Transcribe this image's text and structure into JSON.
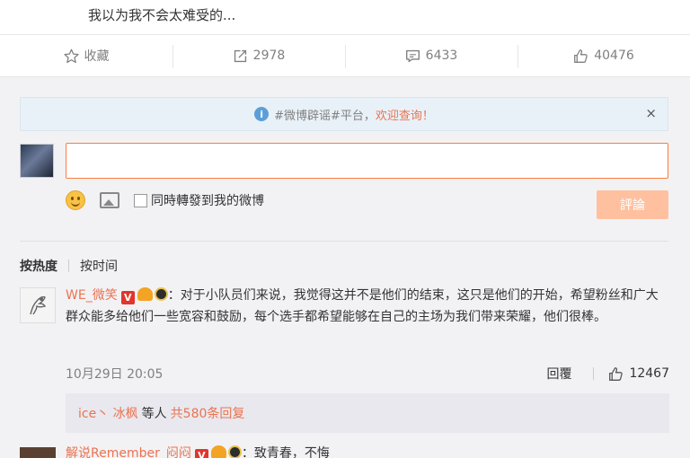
{
  "post": {
    "text": "我以为我不会太难受的..."
  },
  "actions": [
    {
      "label": "收藏",
      "icon": "star-icon"
    },
    {
      "label": "2978",
      "icon": "repost-icon"
    },
    {
      "label": "6433",
      "icon": "comment-icon"
    },
    {
      "label": "40476",
      "icon": "like-icon"
    }
  ],
  "notice": {
    "prefix": "#微博辟谣#平台，",
    "link": "欢迎查询！",
    "close": "×"
  },
  "compose": {
    "input_value": "",
    "forward_label": "同時轉發到我的微博",
    "submit_label": "評論"
  },
  "sort": {
    "active": "按热度",
    "other": "按时间"
  },
  "comments": [
    {
      "user": "WE_微笑",
      "text": "：对于小队员们来说，我觉得这并不是他们的结束，这只是他们的开始，希望粉丝和广大群众能多给他们一些宽容和鼓励，每个选手都希望能够在自己的主场为我们带来荣耀，他们很棒。",
      "time": "10月29日 20:05",
      "reply_label": "回覆",
      "likes": "12467",
      "replies": {
        "users": "ice丶 冰枫",
        "mid": "等人",
        "more": "共580条回复"
      }
    },
    {
      "user": "解说Remember_闷闷",
      "text": "：致青春，不悔"
    }
  ],
  "colors": {
    "accent": "#eb7350",
    "input_border": "#fa7d3c",
    "submit_bg": "#ffc09f",
    "panel_bg": "#f2f2f5"
  }
}
